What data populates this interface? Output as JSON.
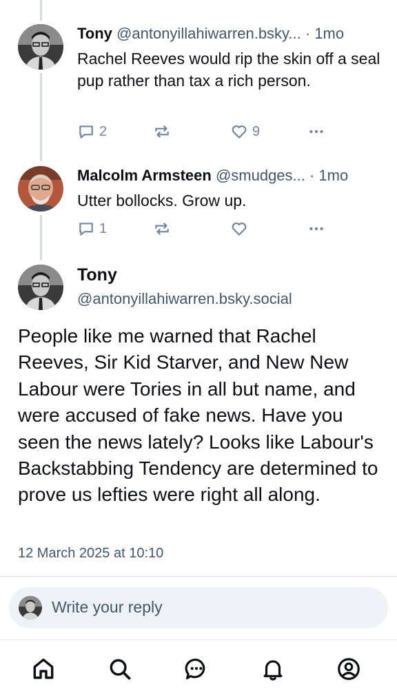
{
  "replies": [
    {
      "author_name": "Tony",
      "author_handle": "@antonyillahiwarren.bsky...",
      "time": " · 1mo",
      "text": "Rachel Reeves would rip the skin off a seal pup rather than tax a rich person.",
      "reply_count": "2",
      "repost_count": "",
      "like_count": "9",
      "avatar_icon": "avatar-man-glasses-bw"
    },
    {
      "author_name": "Malcolm Armsteen",
      "author_handle": "@smudges...",
      "time": " · 1mo",
      "text": "Utter bollocks. Grow up.",
      "reply_count": "1",
      "repost_count": "",
      "like_count": "",
      "avatar_icon": "avatar-man-glasses-color"
    }
  ],
  "main_post": {
    "author_name": "Tony",
    "author_handle": "@antonyillahiwarren.bsky.social",
    "text": "People like me warned that Rachel Reeves, Sir Kid Starver, and New New Labour were Tories in all but name, and were accused of fake news. Have you seen the news lately? Looks like Labour's Backstabbing Tendency are determined to prove us lefties were right all along.",
    "date": "12 March 2025 at 10:10"
  },
  "reply_box": {
    "placeholder": "Write your reply"
  },
  "nav": [
    "home-icon",
    "search-icon",
    "chat-icon",
    "bell-icon",
    "profile-icon"
  ],
  "colors": {
    "text": "#0b0f14",
    "secondary": "#42576c",
    "icon": "#6f869f",
    "thread_line": "#d4dbe2",
    "reply_bg": "#eef2f6"
  }
}
